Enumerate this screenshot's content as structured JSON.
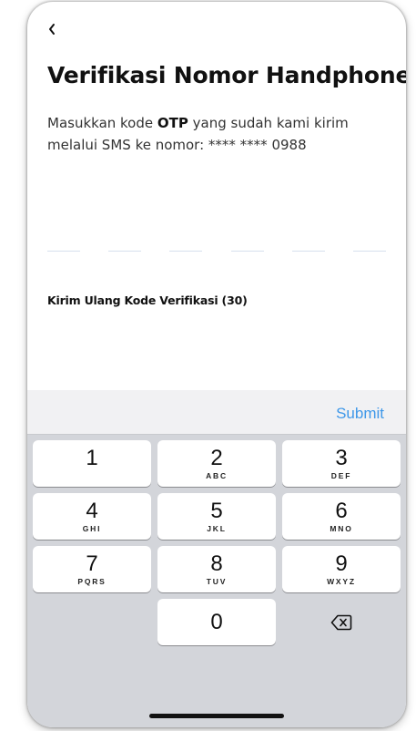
{
  "header": {
    "back_icon": "chevron-left-icon",
    "title": "Verifikasi Nomor Handphone"
  },
  "description": {
    "prefix": "Masukkan kode ",
    "bold": "OTP",
    "suffix": " yang sudah kami kirim melalui SMS ke nomor: **** **** 0988"
  },
  "otp": {
    "slot_count": 6,
    "values": [
      "",
      "",
      "",
      "",
      "",
      ""
    ]
  },
  "resend": {
    "label": "Kirim Ulang Kode Verifikasi (30)"
  },
  "keyboard_toolbar": {
    "submit_label": "Submit",
    "submit_color": "#3f98e9"
  },
  "keypad": {
    "keys": [
      {
        "digit": "1",
        "letters": ""
      },
      {
        "digit": "2",
        "letters": "ABC"
      },
      {
        "digit": "3",
        "letters": "DEF"
      },
      {
        "digit": "4",
        "letters": "GHI"
      },
      {
        "digit": "5",
        "letters": "JKL"
      },
      {
        "digit": "6",
        "letters": "MNO"
      },
      {
        "digit": "7",
        "letters": "PQRS"
      },
      {
        "digit": "8",
        "letters": "TUV"
      },
      {
        "digit": "9",
        "letters": "WXYZ"
      },
      {
        "digit": "0",
        "letters": ""
      }
    ],
    "delete_icon": "backspace-icon"
  },
  "colors": {
    "keyboard_background": "#d3d5da",
    "otp_underline": "#d6e0ee"
  }
}
